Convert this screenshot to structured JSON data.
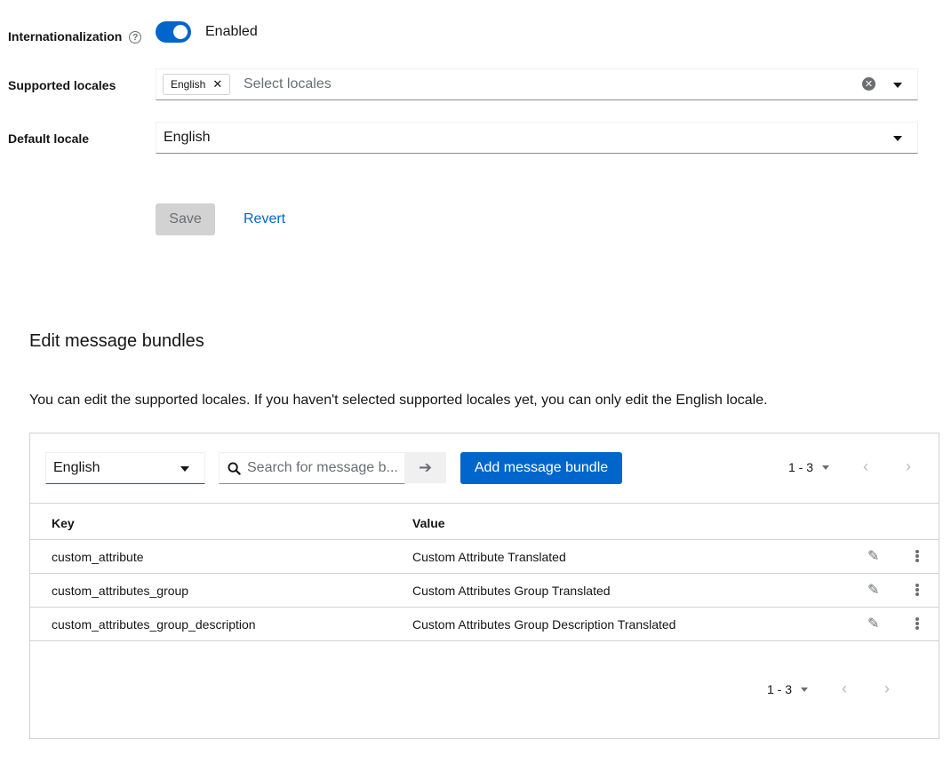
{
  "internationalization": {
    "label": "Internationalization",
    "help_icon": "help-circle-icon",
    "toggle_state": "Enabled"
  },
  "supported_locales": {
    "label": "Supported locales",
    "chips": [
      "English"
    ],
    "placeholder": "Select locales"
  },
  "default_locale": {
    "label": "Default locale",
    "value": "English"
  },
  "actions": {
    "save_label": "Save",
    "revert_label": "Revert"
  },
  "bundles": {
    "title": "Edit message bundles",
    "description": "You can edit the supported locales. If you haven't selected supported locales yet, you can only edit the English locale.",
    "locale_select": "English",
    "search_placeholder": "Search for message b...",
    "add_button": "Add message bundle",
    "pagination_top": "1 - 3",
    "pagination_bottom": "1 - 3",
    "columns": {
      "key": "Key",
      "value": "Value"
    },
    "rows": [
      {
        "key": "custom_attribute",
        "value": "Custom Attribute Translated"
      },
      {
        "key": "custom_attributes_group",
        "value": "Custom Attributes Group Translated"
      },
      {
        "key": "custom_attributes_group_description",
        "value": "Custom Attributes Group Description Translated"
      }
    ]
  },
  "colors": {
    "primary": "#0066cc",
    "border": "#d2d2d2",
    "muted_text": "#6a6e73"
  }
}
